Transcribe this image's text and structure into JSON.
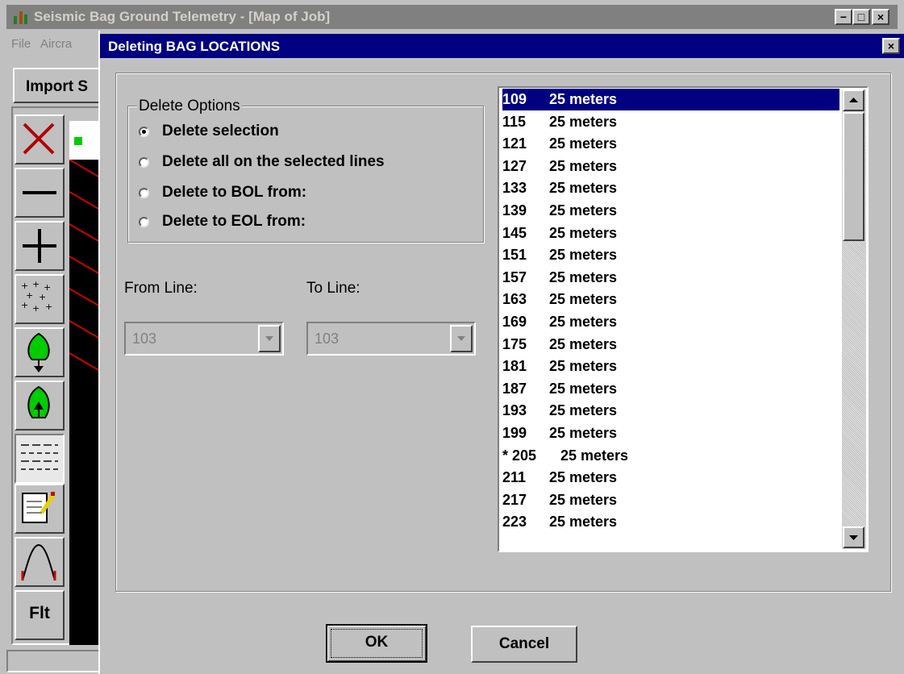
{
  "app": {
    "title": "Seismic Bag Ground Telemetry - [Map of Job]",
    "menu": [
      {
        "label": "File"
      },
      {
        "label": "Aircra"
      }
    ],
    "import_button": "Import S",
    "flt_label": "Flt",
    "controls": [
      "−",
      "□",
      "×"
    ]
  },
  "dialog": {
    "title": "Deleting BAG LOCATIONS",
    "close": "×",
    "group_title": "Delete Options",
    "options": [
      {
        "label": "Delete selection",
        "selected": true
      },
      {
        "label": "Delete all on the selected lines",
        "selected": false
      },
      {
        "label": "Delete to BOL from:",
        "selected": false
      },
      {
        "label": "Delete to EOL from:",
        "selected": false
      }
    ],
    "from_label": "From Line:",
    "to_label": "To Line:",
    "from_value": "103",
    "to_value": "103",
    "list": [
      {
        "num": "109",
        "text": "25 meters"
      },
      {
        "num": "115",
        "text": "25 meters"
      },
      {
        "num": "121",
        "text": "25 meters"
      },
      {
        "num": "127",
        "text": "25 meters"
      },
      {
        "num": "133",
        "text": "25 meters"
      },
      {
        "num": "139",
        "text": "25 meters"
      },
      {
        "num": "145",
        "text": "25 meters"
      },
      {
        "num": "151",
        "text": "25 meters"
      },
      {
        "num": "157",
        "text": "25 meters"
      },
      {
        "num": "163",
        "text": "25 meters"
      },
      {
        "num": "169",
        "text": "25 meters"
      },
      {
        "num": "175",
        "text": "25 meters"
      },
      {
        "num": "181",
        "text": "25 meters"
      },
      {
        "num": "187",
        "text": "25 meters"
      },
      {
        "num": "193",
        "text": "25 meters"
      },
      {
        "num": "199",
        "text": "25 meters"
      },
      {
        "num": "* 205",
        "text": "25 meters"
      },
      {
        "num": "211",
        "text": "25 meters"
      },
      {
        "num": "217",
        "text": "25 meters"
      },
      {
        "num": "223",
        "text": "25 meters"
      }
    ],
    "ok": "OK",
    "cancel": "Cancel"
  },
  "colors": {
    "selection": "#000080",
    "tree": "#00cc00",
    "map_line": "#cc0000"
  }
}
